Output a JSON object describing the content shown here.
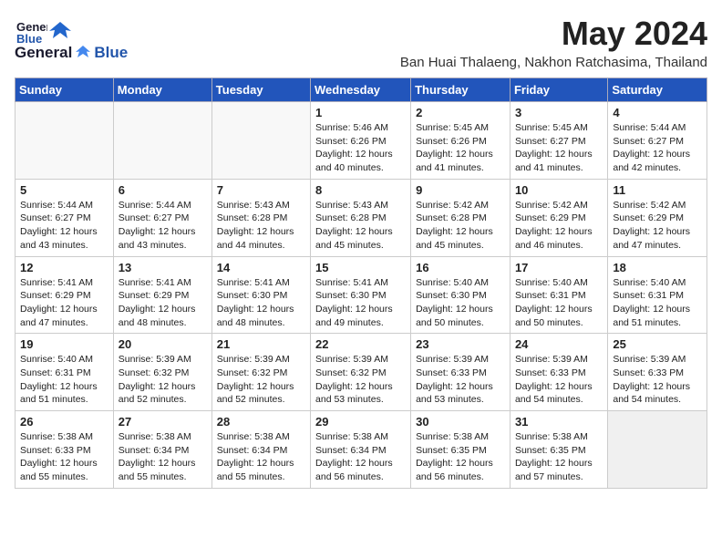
{
  "logo": {
    "general": "General",
    "blue": "Blue"
  },
  "title": "May 2024",
  "location": "Ban Huai Thalaeng, Nakhon Ratchasima, Thailand",
  "weekdays": [
    "Sunday",
    "Monday",
    "Tuesday",
    "Wednesday",
    "Thursday",
    "Friday",
    "Saturday"
  ],
  "weeks": [
    [
      {
        "day": "",
        "info": "",
        "empty": true
      },
      {
        "day": "",
        "info": "",
        "empty": true
      },
      {
        "day": "",
        "info": "",
        "empty": true
      },
      {
        "day": "1",
        "info": "Sunrise: 5:46 AM\nSunset: 6:26 PM\nDaylight: 12 hours\nand 40 minutes."
      },
      {
        "day": "2",
        "info": "Sunrise: 5:45 AM\nSunset: 6:26 PM\nDaylight: 12 hours\nand 41 minutes."
      },
      {
        "day": "3",
        "info": "Sunrise: 5:45 AM\nSunset: 6:27 PM\nDaylight: 12 hours\nand 41 minutes."
      },
      {
        "day": "4",
        "info": "Sunrise: 5:44 AM\nSunset: 6:27 PM\nDaylight: 12 hours\nand 42 minutes."
      }
    ],
    [
      {
        "day": "5",
        "info": "Sunrise: 5:44 AM\nSunset: 6:27 PM\nDaylight: 12 hours\nand 43 minutes."
      },
      {
        "day": "6",
        "info": "Sunrise: 5:44 AM\nSunset: 6:27 PM\nDaylight: 12 hours\nand 43 minutes."
      },
      {
        "day": "7",
        "info": "Sunrise: 5:43 AM\nSunset: 6:28 PM\nDaylight: 12 hours\nand 44 minutes."
      },
      {
        "day": "8",
        "info": "Sunrise: 5:43 AM\nSunset: 6:28 PM\nDaylight: 12 hours\nand 45 minutes."
      },
      {
        "day": "9",
        "info": "Sunrise: 5:42 AM\nSunset: 6:28 PM\nDaylight: 12 hours\nand 45 minutes."
      },
      {
        "day": "10",
        "info": "Sunrise: 5:42 AM\nSunset: 6:29 PM\nDaylight: 12 hours\nand 46 minutes."
      },
      {
        "day": "11",
        "info": "Sunrise: 5:42 AM\nSunset: 6:29 PM\nDaylight: 12 hours\nand 47 minutes."
      }
    ],
    [
      {
        "day": "12",
        "info": "Sunrise: 5:41 AM\nSunset: 6:29 PM\nDaylight: 12 hours\nand 47 minutes."
      },
      {
        "day": "13",
        "info": "Sunrise: 5:41 AM\nSunset: 6:29 PM\nDaylight: 12 hours\nand 48 minutes."
      },
      {
        "day": "14",
        "info": "Sunrise: 5:41 AM\nSunset: 6:30 PM\nDaylight: 12 hours\nand 48 minutes."
      },
      {
        "day": "15",
        "info": "Sunrise: 5:41 AM\nSunset: 6:30 PM\nDaylight: 12 hours\nand 49 minutes."
      },
      {
        "day": "16",
        "info": "Sunrise: 5:40 AM\nSunset: 6:30 PM\nDaylight: 12 hours\nand 50 minutes."
      },
      {
        "day": "17",
        "info": "Sunrise: 5:40 AM\nSunset: 6:31 PM\nDaylight: 12 hours\nand 50 minutes."
      },
      {
        "day": "18",
        "info": "Sunrise: 5:40 AM\nSunset: 6:31 PM\nDaylight: 12 hours\nand 51 minutes."
      }
    ],
    [
      {
        "day": "19",
        "info": "Sunrise: 5:40 AM\nSunset: 6:31 PM\nDaylight: 12 hours\nand 51 minutes."
      },
      {
        "day": "20",
        "info": "Sunrise: 5:39 AM\nSunset: 6:32 PM\nDaylight: 12 hours\nand 52 minutes."
      },
      {
        "day": "21",
        "info": "Sunrise: 5:39 AM\nSunset: 6:32 PM\nDaylight: 12 hours\nand 52 minutes."
      },
      {
        "day": "22",
        "info": "Sunrise: 5:39 AM\nSunset: 6:32 PM\nDaylight: 12 hours\nand 53 minutes."
      },
      {
        "day": "23",
        "info": "Sunrise: 5:39 AM\nSunset: 6:33 PM\nDaylight: 12 hours\nand 53 minutes."
      },
      {
        "day": "24",
        "info": "Sunrise: 5:39 AM\nSunset: 6:33 PM\nDaylight: 12 hours\nand 54 minutes."
      },
      {
        "day": "25",
        "info": "Sunrise: 5:39 AM\nSunset: 6:33 PM\nDaylight: 12 hours\nand 54 minutes."
      }
    ],
    [
      {
        "day": "26",
        "info": "Sunrise: 5:38 AM\nSunset: 6:33 PM\nDaylight: 12 hours\nand 55 minutes."
      },
      {
        "day": "27",
        "info": "Sunrise: 5:38 AM\nSunset: 6:34 PM\nDaylight: 12 hours\nand 55 minutes."
      },
      {
        "day": "28",
        "info": "Sunrise: 5:38 AM\nSunset: 6:34 PM\nDaylight: 12 hours\nand 55 minutes."
      },
      {
        "day": "29",
        "info": "Sunrise: 5:38 AM\nSunset: 6:34 PM\nDaylight: 12 hours\nand 56 minutes."
      },
      {
        "day": "30",
        "info": "Sunrise: 5:38 AM\nSunset: 6:35 PM\nDaylight: 12 hours\nand 56 minutes."
      },
      {
        "day": "31",
        "info": "Sunrise: 5:38 AM\nSunset: 6:35 PM\nDaylight: 12 hours\nand 57 minutes."
      },
      {
        "day": "",
        "info": "",
        "empty": true
      }
    ]
  ]
}
